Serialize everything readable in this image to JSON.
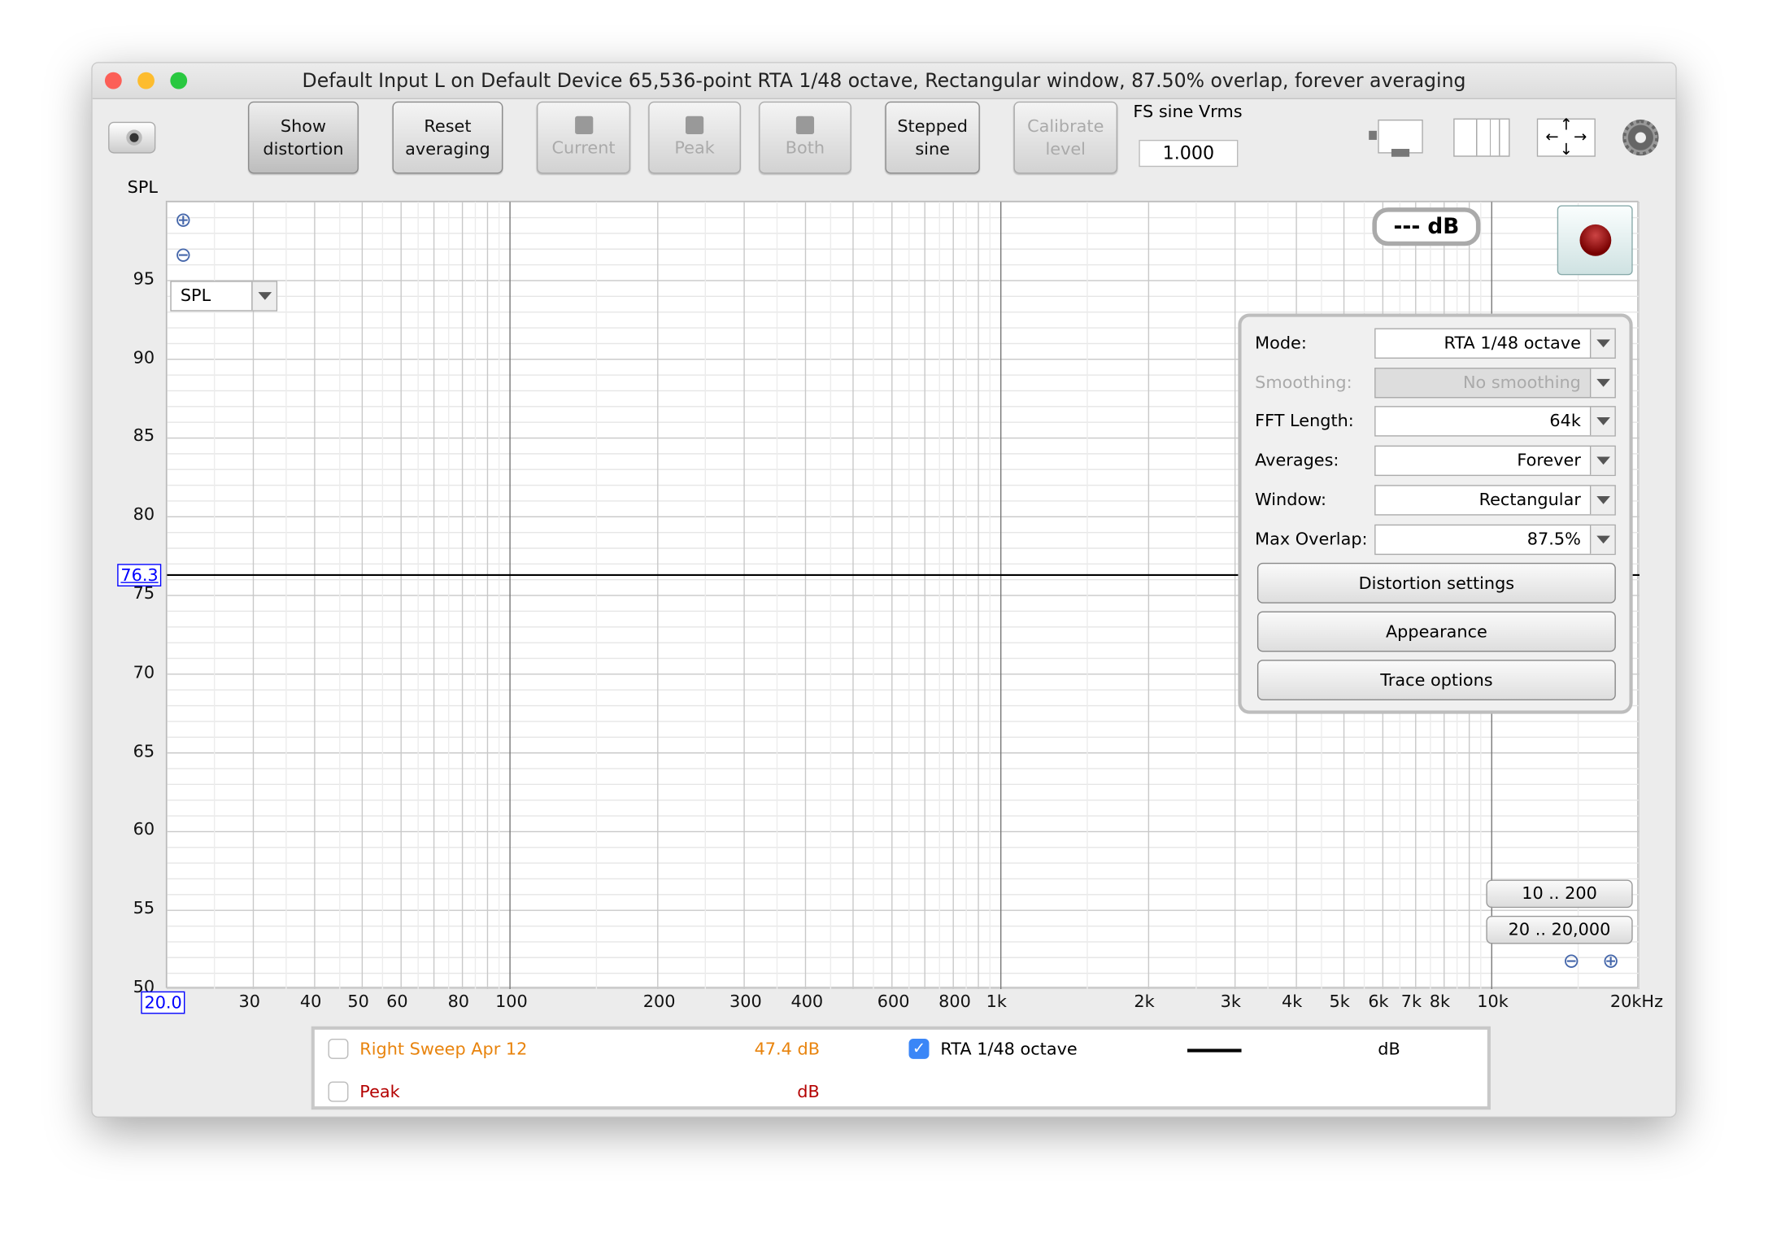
{
  "window": {
    "title": "Default Input L on Default Device 65,536-point RTA 1/48 octave, Rectangular window, 87.50% overlap, forever averaging"
  },
  "toolbar": {
    "show_distortion": "Show distortion",
    "reset_averaging": "Reset averaging",
    "save_current": "Current",
    "save_peak": "Peak",
    "save_both": "Both",
    "stepped_sine": "Stepped sine",
    "calibrate_level": "Calibrate level",
    "fs_sine_label": "FS sine Vrms",
    "fs_sine_value": "1.000"
  },
  "plot": {
    "y_axis_title": "SPL",
    "y_selector": "SPL",
    "cursor_y": "76.3",
    "cursor_x": "20.0",
    "level_readout": "--- dB",
    "range_10_200": "10 .. 200",
    "range_20_20000": "20 .. 20,000"
  },
  "panel": {
    "rows": [
      {
        "label": "Mode:",
        "value": "RTA 1/48 octave",
        "enabled": true
      },
      {
        "label": "Smoothing:",
        "value": "No smoothing",
        "enabled": false
      },
      {
        "label": "FFT Length:",
        "value": "64k",
        "enabled": true
      },
      {
        "label": "Averages:",
        "value": "Forever",
        "enabled": true
      },
      {
        "label": "Window:",
        "value": "Rectangular",
        "enabled": true
      },
      {
        "label": "Max Overlap:",
        "value": "87.5%",
        "enabled": true
      }
    ],
    "distortion_settings": "Distortion settings",
    "appearance": "Appearance",
    "trace_options": "Trace options"
  },
  "legend": {
    "items": [
      {
        "name": "Right Sweep Apr 12",
        "value": "47.4 dB",
        "checked": false,
        "color": "#e8830c"
      },
      {
        "name": "Peak",
        "value": "dB",
        "checked": false,
        "color": "#b40000"
      },
      {
        "name": "RTA 1/48 octave",
        "value": "dB",
        "checked": true,
        "color": "#000000"
      }
    ]
  },
  "chart_data": {
    "type": "line",
    "xlabel": "",
    "ylabel": "SPL",
    "x_scale": "log",
    "xlim": [
      20,
      20000
    ],
    "ylim": [
      50,
      100
    ],
    "grid": true,
    "x_ticks": [
      "20.0",
      "30",
      "40",
      "50",
      "60",
      "80",
      "100",
      "200",
      "300",
      "400",
      "600",
      "800",
      "1k",
      "2k",
      "3k",
      "4k",
      "5k",
      "6k",
      "7k",
      "8k",
      "10k",
      "20kHz"
    ],
    "x_tick_values": [
      20,
      30,
      40,
      50,
      60,
      80,
      100,
      200,
      300,
      400,
      600,
      800,
      1000,
      2000,
      3000,
      4000,
      5000,
      6000,
      7000,
      8000,
      10000,
      20000
    ],
    "y_ticks": [
      95,
      90,
      85,
      80,
      75,
      70,
      65,
      60,
      55,
      50
    ],
    "cursor": {
      "y": 76.3
    },
    "series": []
  }
}
